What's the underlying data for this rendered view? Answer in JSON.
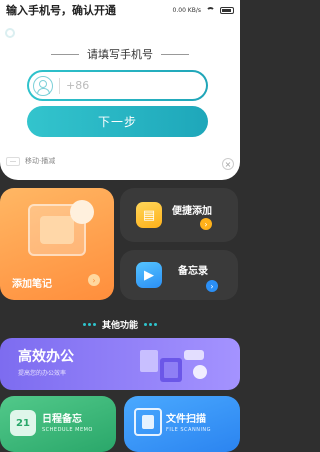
{
  "status_bar": {
    "title": "输入手机号，确认开通",
    "network_speed": "0.00 KB/s"
  },
  "login": {
    "title": "请填写手机号",
    "phone": {
      "prefix": "+86",
      "value": "",
      "placeholder": ""
    },
    "next_label": "下一步",
    "operator_label": "移动·播减"
  },
  "cards": {
    "add_note": "添加笔记",
    "quick_add": "便捷添加",
    "memo": "备忘录"
  },
  "other_section": {
    "title": "其他功能"
  },
  "office": {
    "title": "高效办公",
    "subtitle": "提高您的办公效率"
  },
  "schedule": {
    "title": "日程备忘",
    "subtitle": "SCHEDULE MEMO",
    "icon_text": "21"
  },
  "scan": {
    "title": "文件扫描",
    "subtitle": "FILE SCANNING"
  },
  "colors": {
    "accent": "#2fc3cc",
    "orange": "#ff9a45",
    "purple": "#8c7cf6",
    "green": "#3cb87a",
    "blue": "#3a96f7"
  },
  "icons": {
    "close": "×",
    "arrow": "›"
  }
}
